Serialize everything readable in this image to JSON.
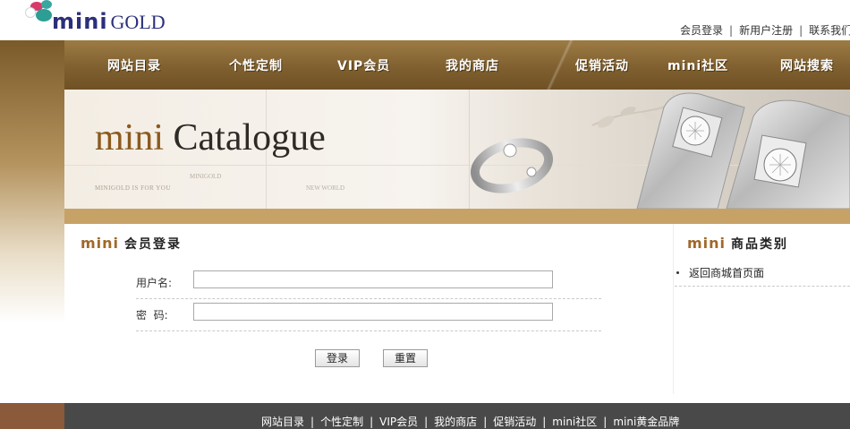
{
  "header": {
    "logo": {
      "mini": "mini",
      "gold": "GOLD"
    },
    "links": [
      "会员登录",
      "新用户注册",
      "联系我们"
    ]
  },
  "nav": {
    "items": [
      "网站目录",
      "个性定制",
      "VIP会员",
      "我的商店",
      "促销活动",
      "mini社区",
      "网站搜索"
    ]
  },
  "banner": {
    "title_mini": "mini",
    "title_rest": "Catalogue",
    "small_text_1": "MINIGOLD IS FOR YOU",
    "small_text_2": "MINIGOLD",
    "small_text_3": "NEW WORLD"
  },
  "login": {
    "header_mini": "mini",
    "header_title": "会员登录",
    "username_label": "用户名:",
    "username_value": "",
    "password_label": "密  码:",
    "password_value": "",
    "login_button": "登录",
    "reset_button": "重置"
  },
  "sidebar": {
    "header_mini": "mini",
    "header_title": "商品类别",
    "items": [
      "返回商城首页面"
    ]
  },
  "footer": {
    "links": [
      "网站目录",
      "个性定制",
      "VIP会员",
      "我的商店",
      "促销活动",
      "mini社区",
      "mini黄金品牌"
    ]
  },
  "colors": {
    "nav_brown": "#80602f",
    "accent_tan": "#c7a267",
    "brand_mini": "#a0692a",
    "footer_gray": "#494949"
  }
}
